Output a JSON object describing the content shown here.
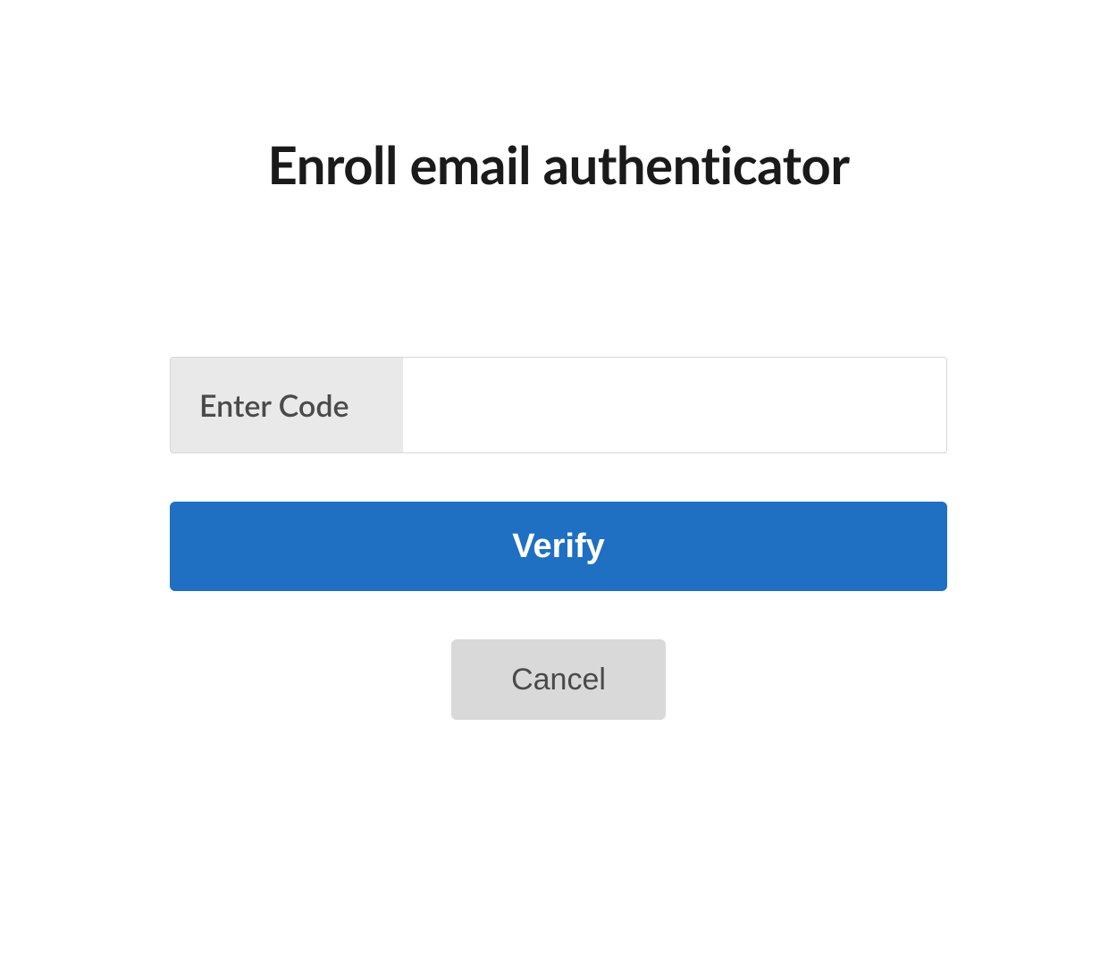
{
  "header": {
    "title": "Enroll email authenticator"
  },
  "form": {
    "code_label": "Enter Code",
    "code_value": "",
    "verify_label": "Verify",
    "cancel_label": "Cancel"
  },
  "colors": {
    "primary": "#1f6fc2",
    "secondary_bg": "#d9d9d9",
    "label_bg": "#e9e9e9",
    "text_dark": "#1a1a1a",
    "text_muted": "#4a4a4a"
  }
}
